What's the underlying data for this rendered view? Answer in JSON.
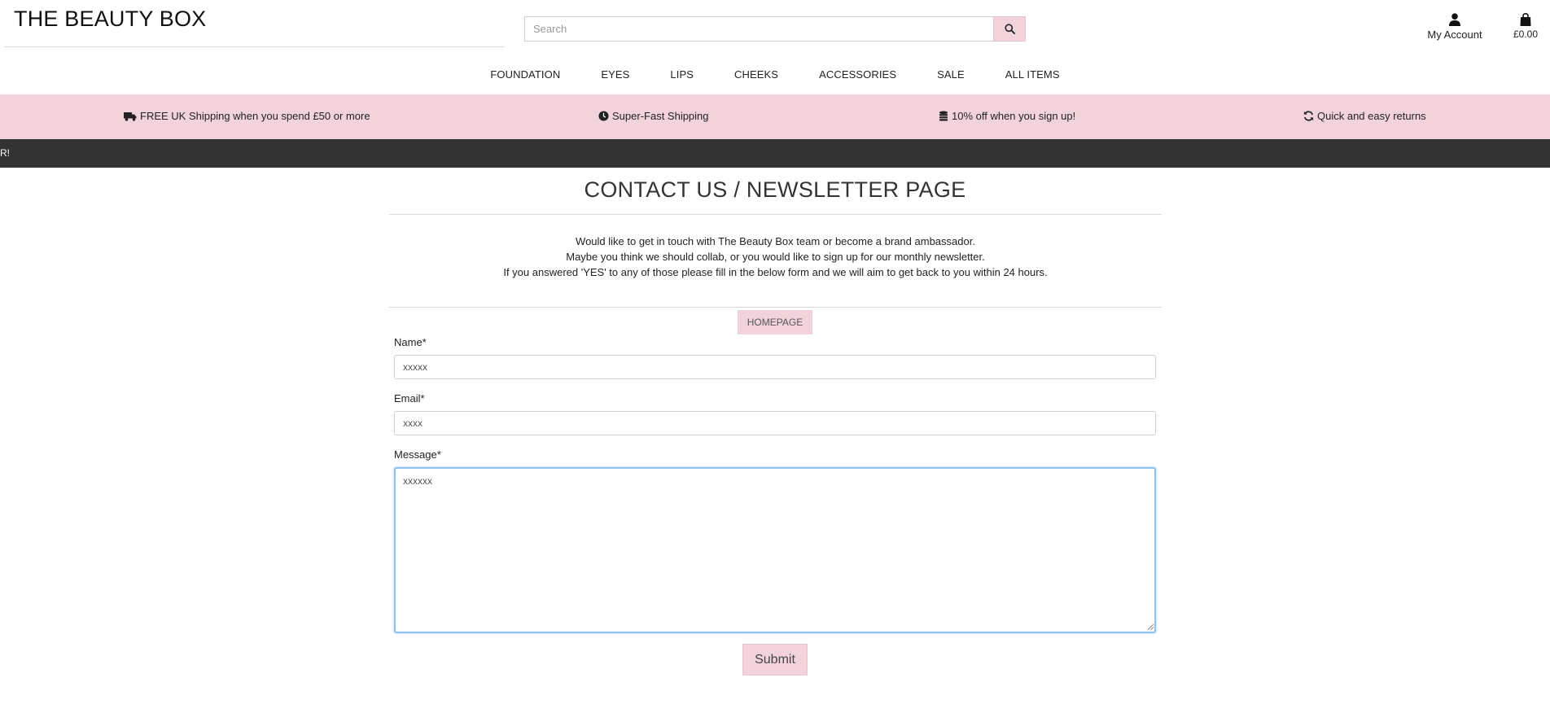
{
  "brand": {
    "name": "THE BEAUTY BOX"
  },
  "search": {
    "placeholder": "Search",
    "icon": "search-icon"
  },
  "account": {
    "label": "My Account",
    "icon": "user-icon"
  },
  "cart": {
    "total": "£0.00",
    "icon": "shopping-bag-icon"
  },
  "nav": {
    "items": [
      {
        "label": "FOUNDATION"
      },
      {
        "label": "EYES"
      },
      {
        "label": "LIPS"
      },
      {
        "label": "CHEEKS"
      },
      {
        "label": "ACCESSORIES"
      },
      {
        "label": "SALE"
      },
      {
        "label": "ALL ITEMS"
      }
    ]
  },
  "promo": {
    "items": [
      {
        "icon": "truck-icon",
        "text": "FREE UK Shipping when you spend £50 or more"
      },
      {
        "icon": "clock-icon",
        "text": "Super-Fast Shipping"
      },
      {
        "icon": "coins-icon",
        "text": "10% off when you sign up!"
      },
      {
        "icon": "refresh-icon",
        "text": "Quick and easy returns"
      }
    ]
  },
  "ticker": {
    "text": "R!"
  },
  "page": {
    "title": "CONTACT US / NEWSLETTER PAGE",
    "intro": [
      "Would like to get in touch with The Beauty Box team or become a brand ambassador.",
      "Maybe you think we should collab, or you would like to sign up for our monthly newsletter.",
      "If you answered 'YES' to any of those please fill in the below form and we will aim to get back to you within 24 hours."
    ],
    "home_button": "HOMEPAGE"
  },
  "form": {
    "name_label": "Name*",
    "name_value": "xxxxx",
    "email_label": "Email*",
    "email_value": "xxxx",
    "message_label": "Message*",
    "message_value": "xxxxxx",
    "submit_label": "Submit"
  },
  "colors": {
    "accent_pink": "#f2d3dc",
    "ticker_dark": "#333333",
    "focus_blue": "#8ec2ee"
  }
}
